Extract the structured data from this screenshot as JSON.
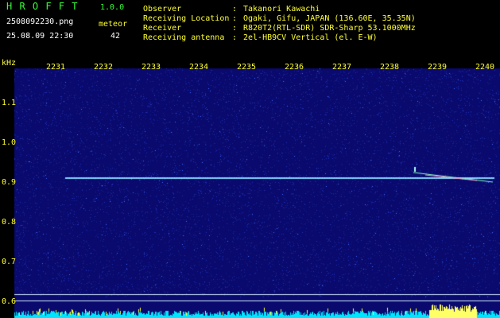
{
  "header": {
    "app_name": "H R O F F T",
    "version": "1.0.0",
    "filename": "2508092230.png",
    "datetime": "25.08.09 22:30",
    "mode_label": "meteor",
    "count": "42",
    "fields": [
      {
        "label": "Observer",
        "sep": ":",
        "value": "Takanori Kawachi"
      },
      {
        "label": "Receiving Location",
        "sep": ":",
        "value": "Ogaki, Gifu, JAPAN (136.60E, 35.35N)"
      },
      {
        "label": "Receiver",
        "sep": ":",
        "value": "R820T2(RTL-SDR) SDR-Sharp 53.1000MHz"
      },
      {
        "label": "Receiving antenna",
        "sep": ":",
        "value": "2el-HB9CV Vertical (el. E-W)"
      }
    ]
  },
  "spectrogram": {
    "unit_label": "kHz",
    "time_ticks": [
      "2231",
      "2232",
      "2233",
      "2234",
      "2235",
      "2236",
      "2237",
      "2238",
      "2239",
      "2240"
    ],
    "freq_ticks": [
      "1.1",
      "1.0",
      "0.9",
      "0.8",
      "0.7",
      "0.6"
    ],
    "colors": {
      "background": "#0a0a6e",
      "noise": "#1a2aa8",
      "signal": "#8fd8ff",
      "tick_label": "#ffff33",
      "baseline": "#00e5ff"
    }
  }
}
